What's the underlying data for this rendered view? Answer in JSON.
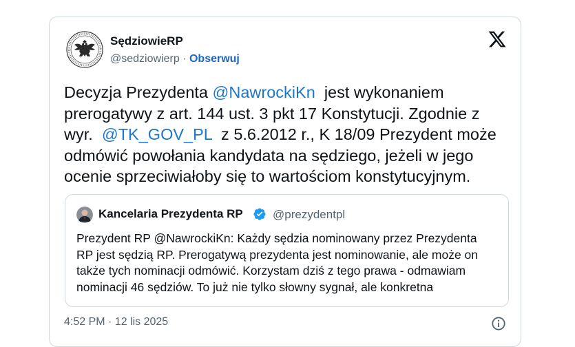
{
  "author": {
    "name": "SędziowieRP",
    "handle": "@sedziowierp",
    "separator": "·",
    "follow_label": "Obserwuj",
    "avatar_icon": "polish-eagle-seal-icon"
  },
  "x_logo": "x-logo-icon",
  "tweet": {
    "lines": [
      {
        "pre": "Decyzja Prezydenta ",
        "mention": "@NawrockiKn",
        "post": "  jest wykonaniem"
      },
      {
        "pre": "prerogatywy z art. 144 ust. 3 pkt 17 Konstytucji. Zgodnie z",
        "mention": "",
        "post": ""
      },
      {
        "pre": "wyr.  ",
        "mention": "@TK_GOV_PL",
        "post": "  z 5.6.2012 r., K 18/09 Prezydent może"
      },
      {
        "pre": "odmówić powołania kandydata na sędziego, jeżeli w jego",
        "mention": "",
        "post": ""
      },
      {
        "pre": "ocenie sprzeciwiałoby się to wartościom konstytucyjnym.",
        "mention": "",
        "post": ""
      }
    ]
  },
  "quote": {
    "name": "Kancelaria Prezydenta RP",
    "verified_icon": "verified-badge-icon",
    "handle": "@prezydentpl",
    "lines": [
      "Prezydent RP @NawrockiKn: Każdy sędzia nominowany przez Prezydenta",
      "RP jest sędzią RP. Prerogatywą prezydenta jest nominowanie, ale może on",
      "także tych nominacji odmówić. Korzystam dziś z tego prawa - odmawiam",
      "nominacji 46 sędziów. To już nie tylko słowny sygnał, ale konkretna"
    ]
  },
  "footer": {
    "timestamp": "4:52 PM · 12 lis 2025",
    "info_icon": "info-icon"
  }
}
